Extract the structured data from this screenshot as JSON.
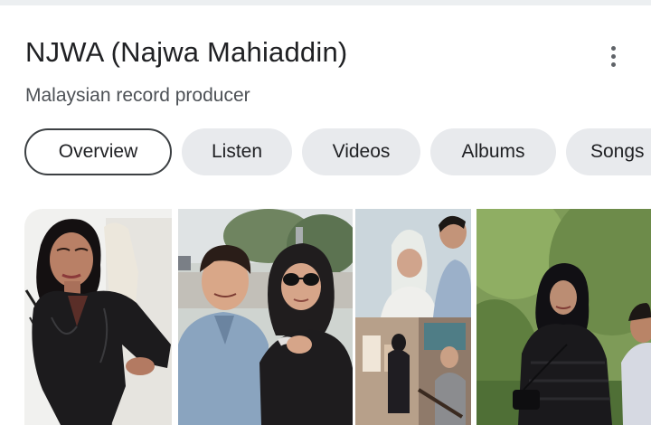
{
  "knowledge_panel": {
    "title": "NJWA (Najwa Mahiaddin)",
    "subtitle": "Malaysian record producer",
    "more_options_icon": "more-vert-icon"
  },
  "tabs": [
    {
      "label": "Overview",
      "selected": true
    },
    {
      "label": "Listen",
      "selected": false
    },
    {
      "label": "Videos",
      "selected": false
    },
    {
      "label": "Albums",
      "selected": false
    },
    {
      "label": "Songs",
      "selected": false
    }
  ],
  "colors": {
    "chip_background": "#e8eaed",
    "selected_chip_border": "#3c4043",
    "title_text": "#202124",
    "subtitle_text": "#4d5156"
  }
}
